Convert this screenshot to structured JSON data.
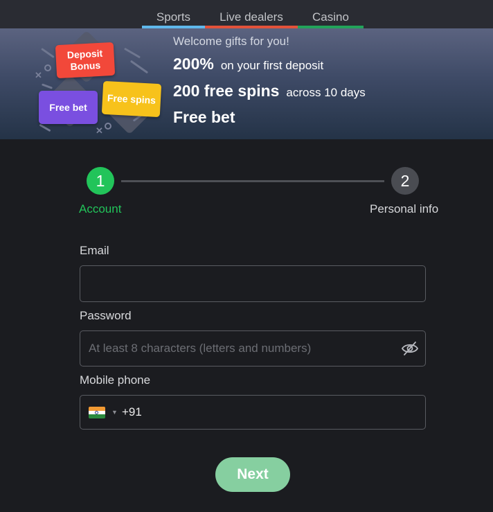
{
  "tabs": [
    {
      "label": "Sports",
      "color": "#5fb8ec"
    },
    {
      "label": "Live dealers",
      "color": "#e2523a"
    },
    {
      "label": "Casino",
      "color": "#22a35a"
    }
  ],
  "banner": {
    "title": "Welcome gifts for you!",
    "tags": {
      "deposit_bonus": "Deposit Bonus",
      "free_bet": "Free bet",
      "free_spins": "Free spins"
    },
    "offers": [
      {
        "highlight": "200%",
        "text": "on your first deposit"
      },
      {
        "highlight": "200 free spins",
        "text": "across 10 days"
      },
      {
        "highlight": "Free bet",
        "text": ""
      }
    ]
  },
  "stepper": {
    "steps": [
      {
        "number": "1",
        "label": "Account",
        "active": true
      },
      {
        "number": "2",
        "label": "Personal info",
        "active": false
      }
    ],
    "active_color": "#22c45a"
  },
  "form": {
    "email": {
      "label": "Email",
      "value": "",
      "placeholder": ""
    },
    "password": {
      "label": "Password",
      "value": "",
      "placeholder": "At least 8 characters (letters and numbers)",
      "toggle_icon": "eye-off-icon"
    },
    "phone": {
      "label": "Mobile phone",
      "country_flag": "india-flag-icon",
      "code": "+91",
      "value": ""
    },
    "submit_label": "Next"
  }
}
